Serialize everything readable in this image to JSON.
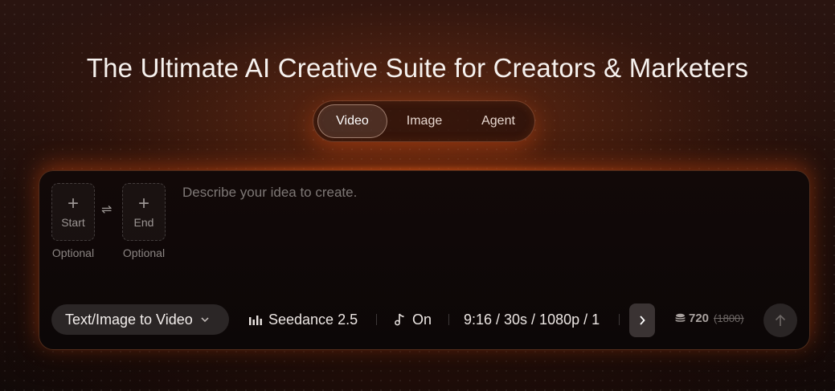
{
  "headline": "The Ultimate AI Creative Suite for Creators & Marketers",
  "tabs": [
    {
      "label": "Video",
      "active": true
    },
    {
      "label": "Image",
      "active": false
    },
    {
      "label": "Agent",
      "active": false
    }
  ],
  "frames": {
    "start": {
      "plus": "+",
      "label": "Start",
      "hint": "Optional"
    },
    "swap": "⇌",
    "end": {
      "plus": "+",
      "label": "End",
      "hint": "Optional"
    }
  },
  "prompt": {
    "value": "",
    "placeholder": "Describe your idea to create."
  },
  "toolbar": {
    "mode": "Text/Image to Video",
    "model": "Seedance 2.5",
    "audio": "On",
    "settings": "9:16 / 30s / 1080p / 1",
    "credits": "720",
    "credits_original": "(1800)"
  },
  "colors": {
    "accent_glow": "#ff6a1e",
    "panel_bg": "#120908",
    "chip_bg": "#2b2626"
  },
  "icons": {
    "model": "bar-chart-icon",
    "audio": "music-note-icon",
    "next": "chevron-right-icon",
    "credits": "coin-stack-icon",
    "send": "arrow-up-icon"
  }
}
